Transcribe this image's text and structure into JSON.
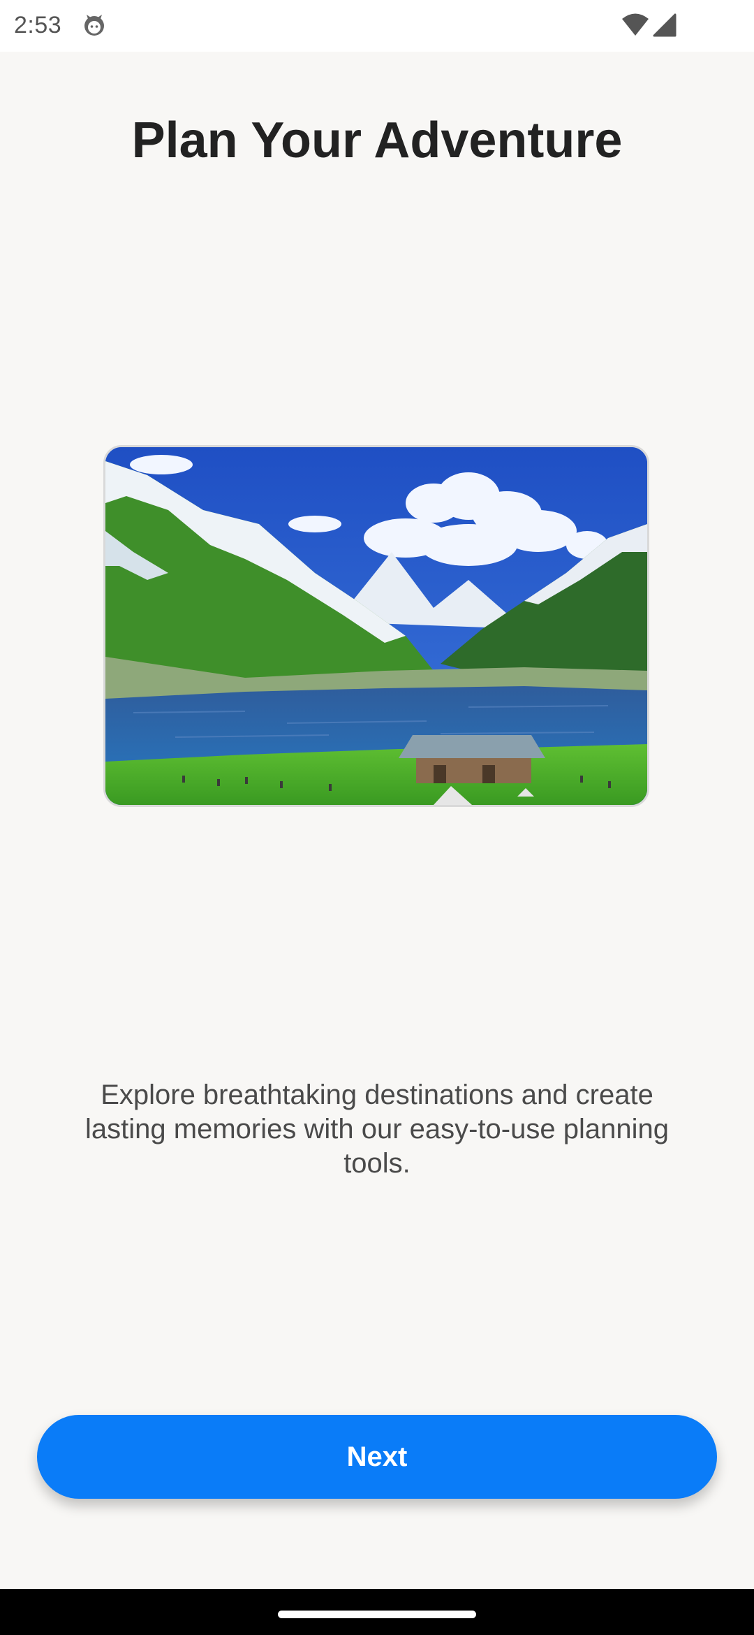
{
  "status_bar": {
    "time": "2:53",
    "icons": [
      "notification-face-icon",
      "wifi-icon",
      "cell-signal-icon"
    ]
  },
  "page": {
    "title": "Plan Your Adventure",
    "description": "Explore breathtaking destinations and create lasting memories with our easy-to-use planning tools.",
    "next_label": "Next"
  },
  "colors": {
    "background": "#f8f7f5",
    "accent": "#0a7cf8",
    "title_text": "#222222",
    "body_text": "#4a4a4a"
  }
}
